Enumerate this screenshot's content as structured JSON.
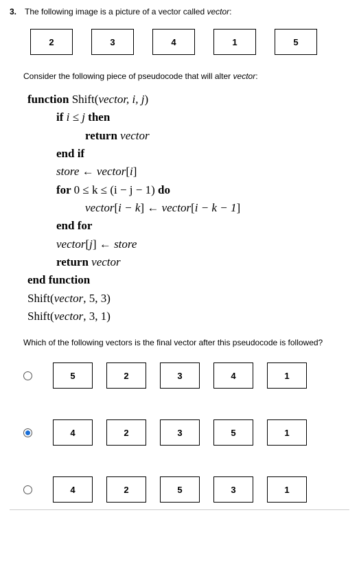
{
  "question": {
    "number": "3.",
    "intro_pre": "The following image is a picture of a vector called ",
    "intro_var": "vector",
    "intro_post": ":",
    "initial_vector": [
      "2",
      "3",
      "4",
      "1",
      "5"
    ],
    "consider_pre": "Consider the following piece of pseudocode that will alter ",
    "consider_var": "vector",
    "consider_post": ":",
    "pseudocode": {
      "l1a": "function",
      "l1b": " Shift(",
      "l1c": "vector, i, j",
      "l1d": ")",
      "l2a": "if ",
      "l2b": "i ≤ j",
      "l2c": " then",
      "l3a": "return ",
      "l3b": "vector",
      "l4": "end if",
      "l5a": "store",
      "l5b": " ← ",
      "l5c": "vector",
      "l5d": "[",
      "l5e": "i",
      "l5f": "]",
      "l6a": "for ",
      "l6b": "0 ≤ k ≤ (i − j − 1)",
      "l6c": " do",
      "l7a": "vector",
      "l7b": "[",
      "l7c": "i − k",
      "l7d": "] ← ",
      "l7e": "vector",
      "l7f": "[",
      "l7g": "i − k − 1",
      "l7h": "]",
      "l8": "end for",
      "l9a": "vector",
      "l9b": "[",
      "l9c": "j",
      "l9d": "] ← ",
      "l9e": "store",
      "l10a": "return ",
      "l10b": "vector",
      "l11": "end function",
      "l12": "Shift(",
      "l12b": "vector",
      "l12c": ", 5, 3)",
      "l13": "Shift(",
      "l13b": "vector",
      "l13c": ", 3, 1)"
    },
    "prompt": "Which of the following vectors is the final vector after this pseudocode is followed?",
    "options": [
      {
        "selected": false,
        "vector": [
          "5",
          "2",
          "3",
          "4",
          "1"
        ]
      },
      {
        "selected": true,
        "vector": [
          "4",
          "2",
          "3",
          "5",
          "1"
        ]
      },
      {
        "selected": false,
        "vector": [
          "4",
          "2",
          "5",
          "3",
          "1"
        ]
      }
    ]
  }
}
